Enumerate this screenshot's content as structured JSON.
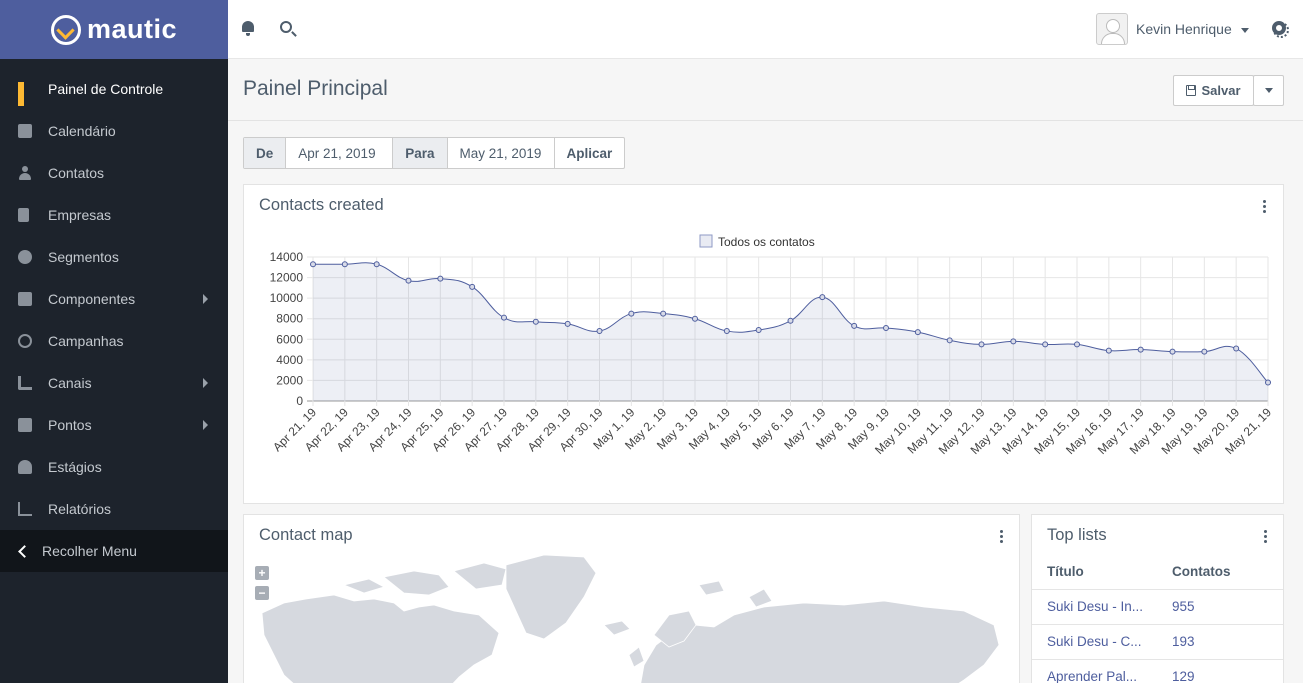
{
  "brand": {
    "name": "mautic"
  },
  "sidebar": {
    "items": [
      {
        "label": "Painel de Controle",
        "icon": "dashboard-icon",
        "active": true
      },
      {
        "label": "Calendário",
        "icon": "calendar-icon"
      },
      {
        "label": "Contatos",
        "icon": "user-icon"
      },
      {
        "label": "Empresas",
        "icon": "building-icon"
      },
      {
        "label": "Segmentos",
        "icon": "pie-chart-icon"
      },
      {
        "label": "Componentes",
        "icon": "puzzle-icon",
        "submenu": true
      },
      {
        "label": "Campanhas",
        "icon": "clock-icon"
      },
      {
        "label": "Canais",
        "icon": "rss-icon",
        "submenu": true
      },
      {
        "label": "Pontos",
        "icon": "calculator-icon",
        "submenu": true
      },
      {
        "label": "Estágios",
        "icon": "tachometer-icon"
      },
      {
        "label": "Relatórios",
        "icon": "line-chart-icon"
      }
    ],
    "collapse_label": "Recolher Menu"
  },
  "topbar": {
    "user_name": "Kevin Henrique"
  },
  "page": {
    "title": "Painel Principal",
    "save_label": "Salvar"
  },
  "date_filter": {
    "from_label": "De",
    "from_value": "Apr 21, 2019",
    "to_label": "Para",
    "to_value": "May 21, 2019",
    "apply_label": "Aplicar"
  },
  "contacts_widget": {
    "title": "Contacts created"
  },
  "chart_data": {
    "type": "area",
    "title": "Contacts created",
    "legend_position": "top-center",
    "grid": true,
    "ylim": [
      0,
      14000
    ],
    "yticks": [
      0,
      2000,
      4000,
      6000,
      8000,
      10000,
      12000,
      14000
    ],
    "x": [
      "Apr 21, 19",
      "Apr 22, 19",
      "Apr 23, 19",
      "Apr 24, 19",
      "Apr 25, 19",
      "Apr 26, 19",
      "Apr 27, 19",
      "Apr 28, 19",
      "Apr 29, 19",
      "Apr 30, 19",
      "May 1, 19",
      "May 2, 19",
      "May 3, 19",
      "May 4, 19",
      "May 5, 19",
      "May 6, 19",
      "May 7, 19",
      "May 8, 19",
      "May 9, 19",
      "May 10, 19",
      "May 11, 19",
      "May 12, 19",
      "May 13, 19",
      "May 14, 19",
      "May 15, 19",
      "May 16, 19",
      "May 17, 19",
      "May 18, 19",
      "May 19, 19",
      "May 20, 19",
      "May 21, 19"
    ],
    "series": [
      {
        "name": "Todos os contatos",
        "color": "#4e5e9e",
        "values": [
          13300,
          13300,
          13300,
          11700,
          11900,
          11100,
          8100,
          7700,
          7500,
          6800,
          8500,
          8500,
          8000,
          6800,
          6900,
          7800,
          10100,
          7300,
          7100,
          6700,
          5900,
          5500,
          5800,
          5500,
          5500,
          4900,
          5000,
          4800,
          4800,
          5100,
          1800
        ]
      }
    ]
  },
  "map_widget": {
    "title": "Contact map",
    "zoom_in": "+",
    "zoom_out": "−"
  },
  "top_lists": {
    "title": "Top lists",
    "headers": {
      "title": "Título",
      "count": "Contatos"
    },
    "rows": [
      {
        "title": "Suki Desu - In...",
        "count": "955"
      },
      {
        "title": "Suki Desu - C...",
        "count": "193"
      },
      {
        "title": "Aprender Pal...",
        "count": "129"
      }
    ]
  }
}
